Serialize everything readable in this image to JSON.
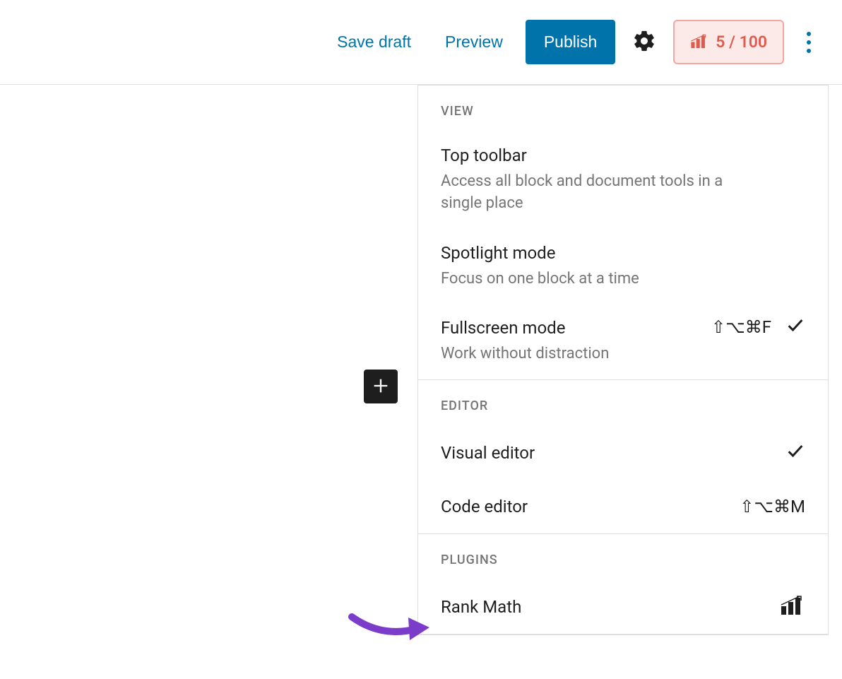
{
  "toolbar": {
    "save_draft": "Save draft",
    "preview": "Preview",
    "publish": "Publish",
    "score": "5 / 100"
  },
  "dropdown": {
    "section_view": "VIEW",
    "section_editor": "EDITOR",
    "section_plugins": "PLUGINS",
    "items": {
      "top_toolbar": {
        "label": "Top toolbar",
        "desc": "Access all block and document tools in a single place"
      },
      "spotlight": {
        "label": "Spotlight mode",
        "desc": "Focus on one block at a time"
      },
      "fullscreen": {
        "label": "Fullscreen mode",
        "desc": "Work without distraction",
        "shortcut": "⇧⌥⌘F"
      },
      "visual_editor": {
        "label": "Visual editor"
      },
      "code_editor": {
        "label": "Code editor",
        "shortcut": "⇧⌥⌘M"
      },
      "rank_math": {
        "label": "Rank Math"
      }
    }
  }
}
